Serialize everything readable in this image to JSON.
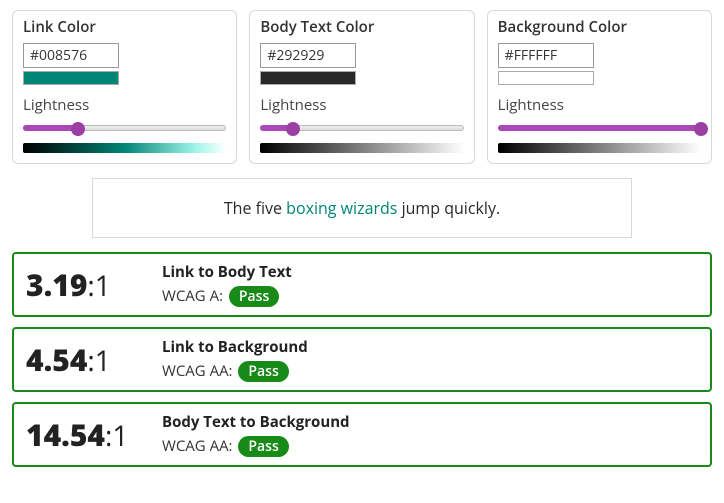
{
  "pickers": [
    {
      "title": "Link Color",
      "hex": "#008576",
      "lightness_label": "Lightness",
      "slider_pct": 27,
      "gradient_css": "linear-gradient(to right, #000000, #008576 50%, #9ff5ea 85%, #ffffff)"
    },
    {
      "title": "Body Text Color",
      "hex": "#292929",
      "lightness_label": "Lightness",
      "slider_pct": 16,
      "gradient_css": "linear-gradient(to right, #000000, #292929 16%, #ffffff)"
    },
    {
      "title": "Background Color",
      "hex": "#FFFFFF",
      "lightness_label": "Lightness",
      "slider_pct": 100,
      "gradient_css": "linear-gradient(to right, #000000, #ffffff)"
    }
  ],
  "sample": {
    "before": "The five ",
    "link": "boxing wizards",
    "after": " jump quickly.",
    "link_color": "#008576",
    "text_color": "#292929",
    "bg_color": "#FFFFFF"
  },
  "results": [
    {
      "ratio": "3.19",
      "suffix": ":1",
      "title": "Link to Body Text",
      "wcag_level": "WCAG A:",
      "status": "Pass"
    },
    {
      "ratio": "4.54",
      "suffix": ":1",
      "title": "Link to Background",
      "wcag_level": "WCAG AA:",
      "status": "Pass"
    },
    {
      "ratio": "14.54",
      "suffix": ":1",
      "title": "Body Text to Background",
      "wcag_level": "WCAG AA:",
      "status": "Pass"
    }
  ]
}
